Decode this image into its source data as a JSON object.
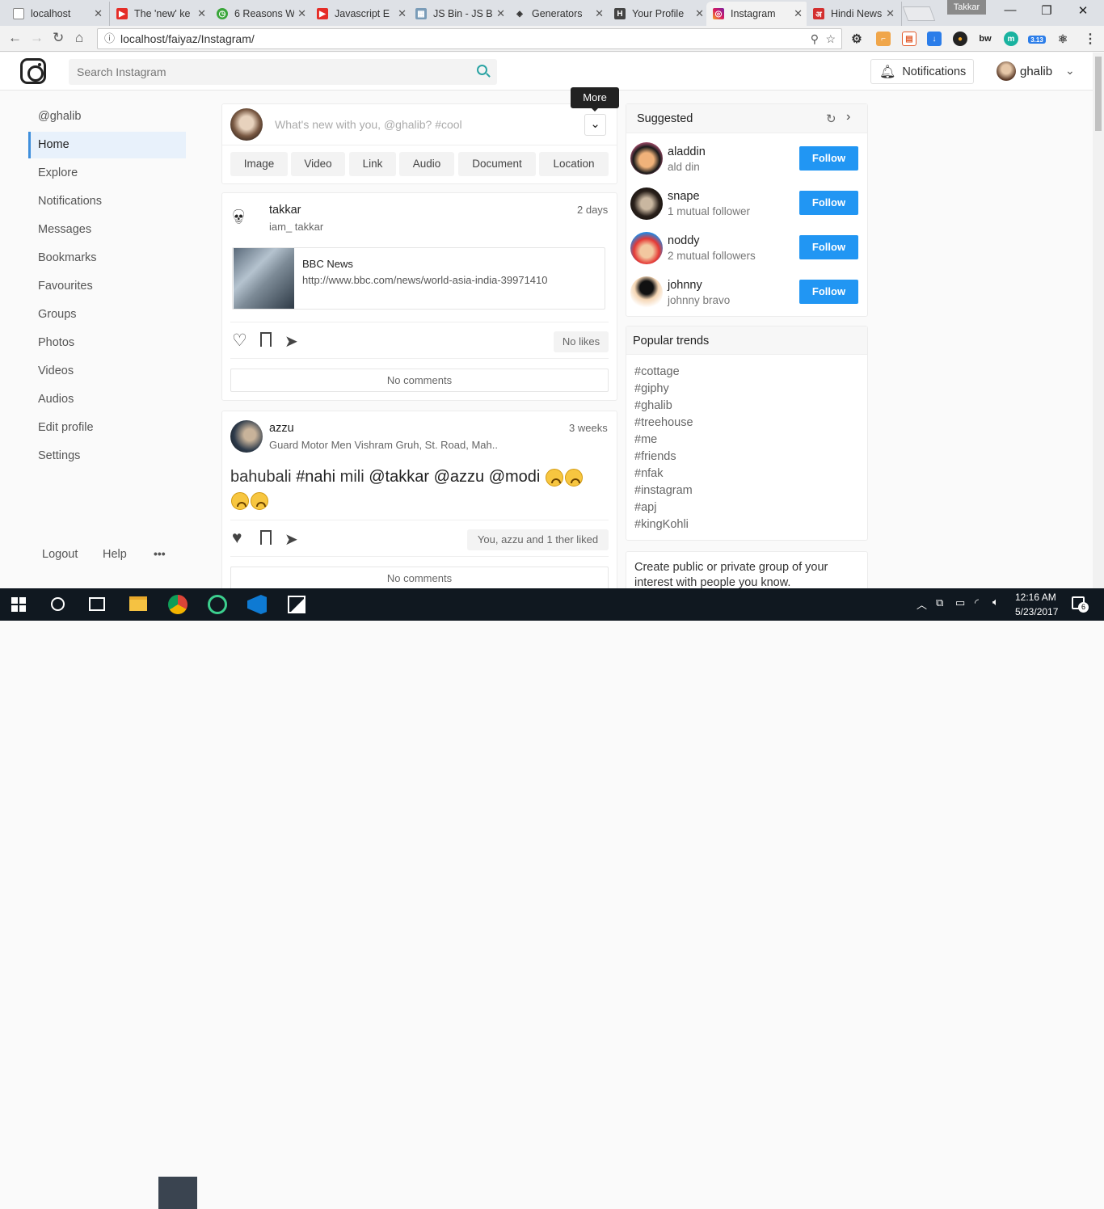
{
  "browser": {
    "tabs": [
      {
        "label": "localhost",
        "icon": "page-icon"
      },
      {
        "label": "The 'new' ke",
        "icon": "youtube-icon"
      },
      {
        "label": "6 Reasons W",
        "icon": "clock-icon"
      },
      {
        "label": "Javascript E",
        "icon": "youtube-icon"
      },
      {
        "label": "JS Bin - JS B",
        "icon": "jsbin-icon"
      },
      {
        "label": "Generators",
        "icon": "codepen-icon"
      },
      {
        "label": "Your Profile",
        "icon": "h-icon"
      },
      {
        "label": "Instagram",
        "icon": "instagram-icon"
      },
      {
        "label": "Hindi News",
        "icon": "news-icon"
      }
    ],
    "profile_label": "Takkar",
    "url": "localhost/faiyaz/Instagram/",
    "ext_badge": "3.13"
  },
  "header": {
    "search_placeholder": "Search Instagram",
    "notifications_label": "Notifications",
    "username": "ghalib"
  },
  "sidebar": {
    "handle": "@ghalib",
    "items": [
      "Home",
      "Explore",
      "Notifications",
      "Messages",
      "Bookmarks",
      "Favourites",
      "Groups",
      "Photos",
      "Videos",
      "Audios",
      "Edit profile",
      "Settings"
    ],
    "active": "Home",
    "footer": {
      "logout": "Logout",
      "help": "Help",
      "more": "•••"
    }
  },
  "composer": {
    "placeholder": "What's new with you, @ghalib? #cool",
    "tooltip": "More",
    "types": [
      "Image",
      "Video",
      "Link",
      "Audio",
      "Document",
      "Location"
    ]
  },
  "posts": [
    {
      "user": "takkar",
      "subtitle": "iam_ takkar",
      "time": "2 days",
      "link_title": "BBC News",
      "link_url": "http://www.bbc.com/news/world-asia-india-39971410",
      "likes": "No likes",
      "comments": "No comments"
    },
    {
      "user": "azzu",
      "subtitle": "Guard Motor Men Vishram Gruh, St. Road, Mah..",
      "time": "3 weeks",
      "text_parts": [
        "bahubali ",
        "#nahi",
        " mili ",
        "@takkar",
        " ",
        "@azzu",
        " ",
        "@modi"
      ],
      "likes": "You, azzu and 1 ther liked",
      "comments": "No comments"
    }
  ],
  "suggested": {
    "title": "Suggested",
    "follow_label": "Follow",
    "users": [
      {
        "name": "aladdin",
        "sub": "ald din"
      },
      {
        "name": "snape",
        "sub": "1 mutual follower"
      },
      {
        "name": "noddy",
        "sub": "2 mutual followers"
      },
      {
        "name": "johnny",
        "sub": "johnny bravo"
      }
    ]
  },
  "trends": {
    "title": "Popular trends",
    "tags": [
      "#cottage",
      "#giphy",
      "#ghalib",
      "#treehouse",
      "#me",
      "#friends",
      "#nfak",
      "#instagram",
      "#apj",
      "#kingKohli"
    ]
  },
  "groups_promo": {
    "text": "Create public or private group of your interest with people you know."
  },
  "taskbar": {
    "time": "12:16 AM",
    "date": "5/23/2017",
    "notif_count": "6"
  }
}
